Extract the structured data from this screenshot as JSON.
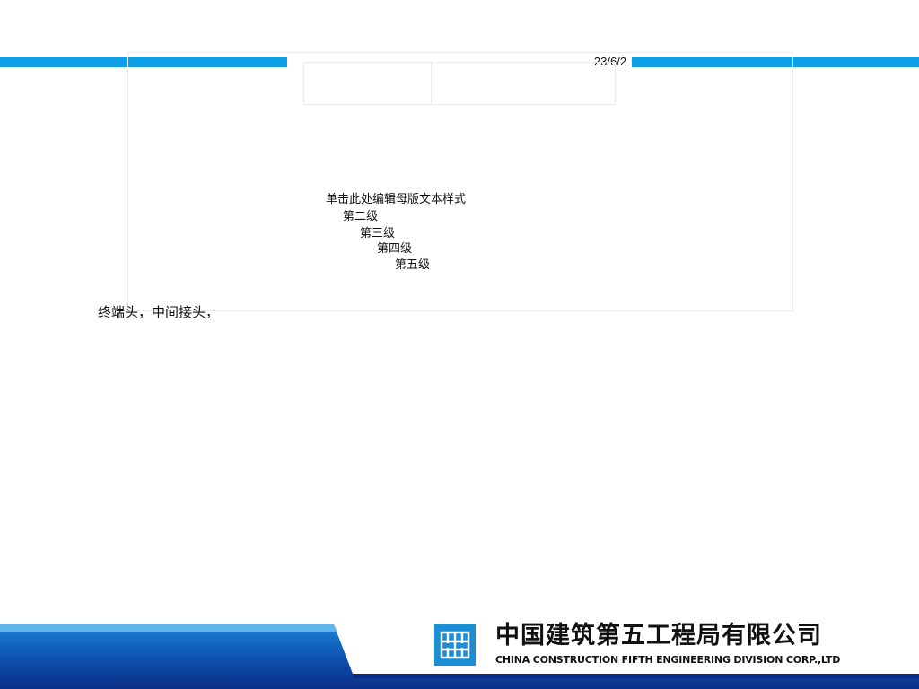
{
  "header": {
    "date": "23/6/2",
    "title_line_1": "",
    "title_line_2": ""
  },
  "master_text": {
    "level_1": "单击此处编辑母版文本样式",
    "level_2": "第二级",
    "level_3": "第三级",
    "level_4": "第四级",
    "level_5": "第五级"
  },
  "body": {
    "text": "终端头，中间接头，"
  },
  "footer": {
    "company_cn": "中国建筑第五工程局有限公司",
    "company_en": "CHINA CONSTRUCTION FIFTH ENGINEERING DIVISION CORP.,LTD",
    "logo_icon": "cscec-logo-icon"
  },
  "colors": {
    "accent_blue": "#0da0e6",
    "logo_blue": "#1a8fd8",
    "footer_navy": "#0b2f86",
    "footer_blue": "#1b84d6"
  }
}
